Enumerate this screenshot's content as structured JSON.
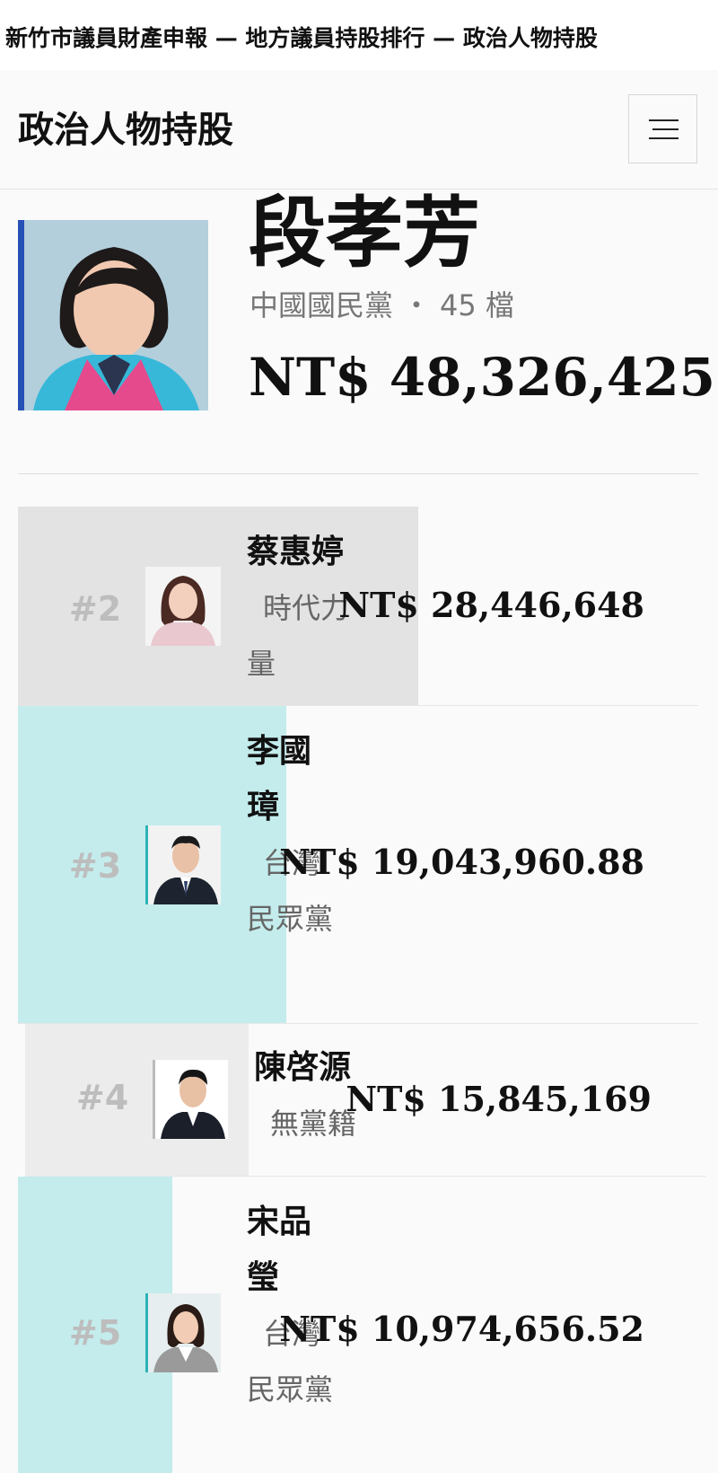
{
  "caption": "新竹市議員財產申報 — 地方議員持股排行 — 政治人物持股",
  "app": {
    "title": "政治人物持股"
  },
  "top": {
    "name": "段孝芳",
    "party": "中國國民黨",
    "separator": "・",
    "holdings": "45 檔",
    "amount": "NT$ 48,326,425"
  },
  "ranking": [
    {
      "rank": "#2",
      "name": "蔡惠婷",
      "party": "時代力量",
      "amount": "NT$ 28,446,648",
      "bar_fill_fraction": 0.589,
      "bar_color": "#e3e3e3"
    },
    {
      "rank": "#3",
      "name": "李國璋",
      "party": "台灣民眾黨",
      "amount": "NT$ 19,043,960.88",
      "bar_fill_fraction": 0.394,
      "bar_color": "#c4ecec"
    },
    {
      "rank": "#4",
      "name": "陳啓源",
      "party": "無黨籍",
      "amount": "NT$ 15,845,169",
      "bar_fill_fraction": 0.328,
      "bar_color": "#ececec"
    },
    {
      "rank": "#5",
      "name": "宋品瑩",
      "party": "台灣民眾黨",
      "amount": "NT$ 10,974,656.52",
      "bar_fill_fraction": 0.227,
      "bar_color": "#c4ecec"
    }
  ]
}
